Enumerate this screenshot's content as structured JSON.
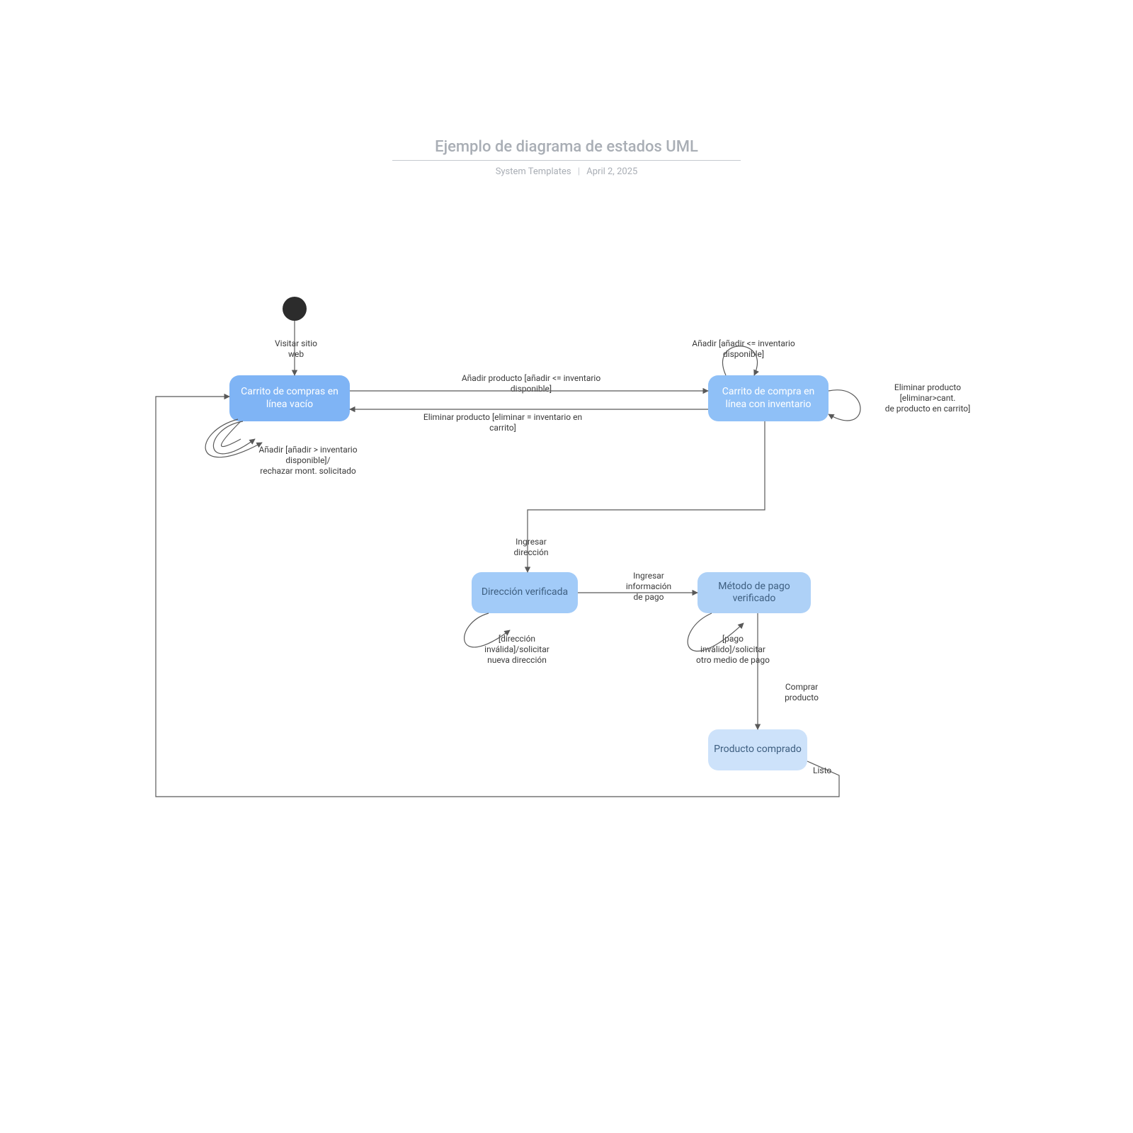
{
  "header": {
    "title": "Ejemplo de diagrama de estados UML",
    "subtitle_left": "System Templates",
    "subtitle_right": "April 2, 2025"
  },
  "states": {
    "empty_cart": "Carrito de\ncompras en línea\nvacío",
    "cart_with_inventory": "Carrito de compra\nen línea con\ninventario",
    "address_verified": "Dirección\nverificada",
    "payment_verified": "Método de pago\nverificado",
    "purchased": "Producto\ncomprado"
  },
  "transitions": {
    "visit_site": "Visitar sitio\nweb",
    "add_prod_avail": "Añadir producto [añadir <= inventario\ndisponible]",
    "remove_eq_cart": "Eliminar producto [eliminar = inventario en\ncarrito]",
    "add_gt_avail": "Añadir [añadir > inventario\ndisponible]/\nrechazar mont. solicitado",
    "add_le_avail_self": "Añadir [añadir <= inventario\ndisponible]",
    "remove_gt_cart": "Eliminar producto\n[eliminar>cant.\nde producto en carrito]",
    "enter_address": "Ingresar\ndirección",
    "invalid_address": "[dirección\ninválida]/solicitar\nnueva dirección",
    "enter_payment": "Ingresar\ninformación\nde pago",
    "invalid_payment": "[pago\ninválido]/solicitar\notro medio de pago",
    "buy_product": "Comprar\nproducto",
    "done": "Listo"
  },
  "colors": {
    "state1": "#7fb4f5",
    "state2": "#8fc0f7",
    "state3": "#a2cbf8",
    "state4": "#aed1f7",
    "state5": "#cde2fa",
    "edge": "#595959",
    "title": "#A9AEB5"
  }
}
